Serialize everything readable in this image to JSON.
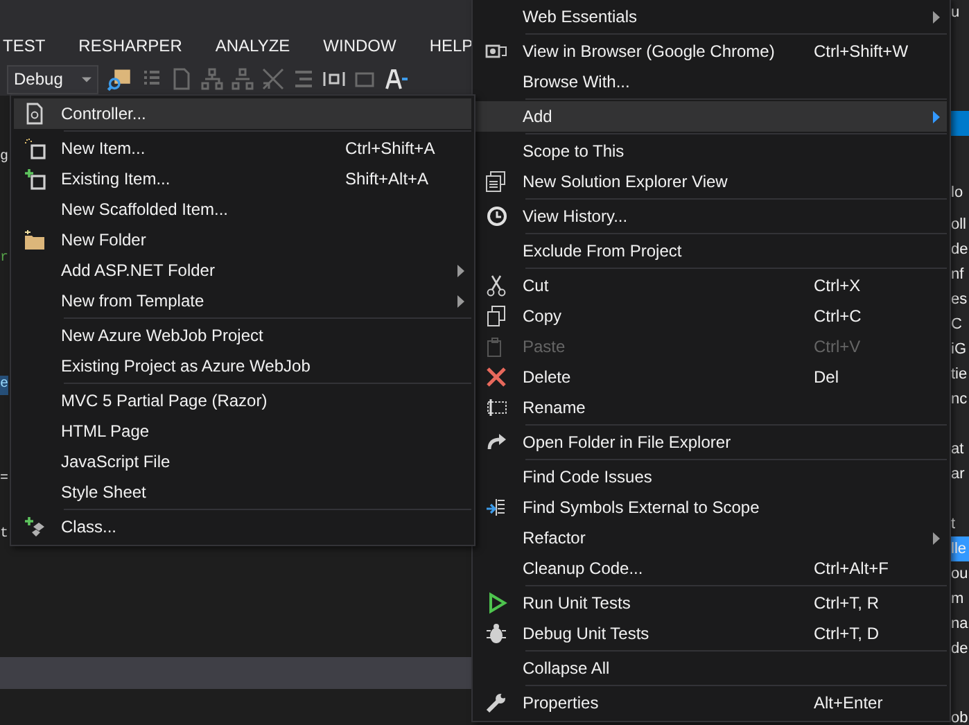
{
  "menubar": [
    {
      "label": "TEST"
    },
    {
      "label": "RESHARPER"
    },
    {
      "label": "ANALYZE"
    },
    {
      "label": "WINDOW"
    },
    {
      "label": "HELP"
    }
  ],
  "toolbar": {
    "configuration": "Debug"
  },
  "editor_fragments": [
    {
      "text": "g",
      "kind": "plain"
    },
    {
      "text": "r",
      "kind": "green"
    },
    {
      "text": "e",
      "kind": "highlight"
    },
    {
      "text": "=",
      "kind": "plain"
    },
    {
      "text": "t",
      "kind": "plain"
    }
  ],
  "solution_explorer": {
    "top_text": "u",
    "header_text": "lo",
    "rows": [
      {
        "kind": "row",
        "text": "oll",
        "selected": false
      },
      {
        "kind": "row",
        "text": "de",
        "selected": false
      },
      {
        "kind": "row",
        "text": "nf",
        "selected": false
      },
      {
        "kind": "row",
        "text": "es",
        "selected": false
      },
      {
        "kind": "row",
        "text": "C",
        "selected": false
      },
      {
        "kind": "row",
        "text": "iG",
        "selected": false
      },
      {
        "kind": "row",
        "text": "tie",
        "selected": false
      },
      {
        "kind": "row",
        "text": "nc",
        "selected": false
      },
      {
        "kind": "spacer"
      },
      {
        "kind": "row",
        "text": "at",
        "selected": false
      },
      {
        "kind": "row",
        "text": "ar",
        "selected": false
      },
      {
        "kind": "spacer"
      },
      {
        "kind": "row",
        "text": "t",
        "selected": false
      },
      {
        "kind": "row",
        "text": "lle",
        "selected": true
      },
      {
        "kind": "row",
        "text": "ou",
        "selected": false
      },
      {
        "kind": "row",
        "text": "m",
        "selected": false
      },
      {
        "kind": "row",
        "text": "na",
        "selected": false
      },
      {
        "kind": "row",
        "text": "de",
        "selected": false
      }
    ],
    "bottom_text": "ob"
  },
  "context_menu": {
    "items": [
      {
        "kind": "item",
        "label": "Web Essentials",
        "submenu": true,
        "selected": false,
        "disabled": false
      },
      {
        "kind": "separator"
      },
      {
        "kind": "item",
        "label": "View in Browser (Google Chrome)",
        "shortcut": "Ctrl+Shift+W",
        "selected": false,
        "disabled": false
      },
      {
        "kind": "item",
        "label": "Browse With...",
        "selected": false,
        "disabled": false
      },
      {
        "kind": "separator"
      },
      {
        "kind": "item",
        "label": "Add",
        "submenu": true,
        "selected": true,
        "disabled": false
      },
      {
        "kind": "separator"
      },
      {
        "kind": "item",
        "label": "Scope to This",
        "selected": false,
        "disabled": false
      },
      {
        "kind": "item",
        "label": "New Solution Explorer View",
        "selected": false,
        "disabled": false
      },
      {
        "kind": "separator"
      },
      {
        "kind": "item",
        "label": "View History...",
        "selected": false,
        "disabled": false
      },
      {
        "kind": "separator"
      },
      {
        "kind": "item",
        "label": "Exclude From Project",
        "selected": false,
        "disabled": false
      },
      {
        "kind": "separator"
      },
      {
        "kind": "item",
        "label": "Cut",
        "shortcut": "Ctrl+X",
        "selected": false,
        "disabled": false
      },
      {
        "kind": "item",
        "label": "Copy",
        "shortcut": "Ctrl+C",
        "selected": false,
        "disabled": false
      },
      {
        "kind": "item",
        "label": "Paste",
        "shortcut": "Ctrl+V",
        "selected": false,
        "disabled": true
      },
      {
        "kind": "item",
        "label": "Delete",
        "shortcut": "Del",
        "selected": false,
        "disabled": false
      },
      {
        "kind": "item",
        "label": "Rename",
        "selected": false,
        "disabled": false
      },
      {
        "kind": "separator"
      },
      {
        "kind": "item",
        "label": "Open Folder in File Explorer",
        "selected": false,
        "disabled": false
      },
      {
        "kind": "separator"
      },
      {
        "kind": "item",
        "label": "Find Code Issues",
        "selected": false,
        "disabled": false
      },
      {
        "kind": "item",
        "label": "Find Symbols External to Scope",
        "selected": false,
        "disabled": false
      },
      {
        "kind": "item",
        "label": "Refactor",
        "submenu": true,
        "selected": false,
        "disabled": false
      },
      {
        "kind": "item",
        "label": "Cleanup Code...",
        "shortcut": "Ctrl+Alt+F",
        "selected": false,
        "disabled": false
      },
      {
        "kind": "separator"
      },
      {
        "kind": "item",
        "label": "Run Unit Tests",
        "shortcut": "Ctrl+T, R",
        "selected": false,
        "disabled": false
      },
      {
        "kind": "item",
        "label": "Debug Unit Tests",
        "shortcut": "Ctrl+T, D",
        "selected": false,
        "disabled": false
      },
      {
        "kind": "separator"
      },
      {
        "kind": "item",
        "label": "Collapse All",
        "selected": false,
        "disabled": false
      },
      {
        "kind": "separator"
      },
      {
        "kind": "item",
        "label": "Properties",
        "shortcut": "Alt+Enter",
        "selected": false,
        "disabled": false
      }
    ]
  },
  "add_submenu": {
    "items": [
      {
        "kind": "item",
        "label": "Controller...",
        "selected": true,
        "disabled": false
      },
      {
        "kind": "separator"
      },
      {
        "kind": "item",
        "label": "New Item...",
        "shortcut": "Ctrl+Shift+A",
        "selected": false,
        "disabled": false
      },
      {
        "kind": "item",
        "label": "Existing Item...",
        "shortcut": "Shift+Alt+A",
        "selected": false,
        "disabled": false
      },
      {
        "kind": "item",
        "label": "New Scaffolded Item...",
        "selected": false,
        "disabled": false
      },
      {
        "kind": "item",
        "label": "New Folder",
        "selected": false,
        "disabled": false
      },
      {
        "kind": "item",
        "label": "Add ASP.NET Folder",
        "submenu": true,
        "selected": false,
        "disabled": false
      },
      {
        "kind": "item",
        "label": "New from Template",
        "submenu": true,
        "selected": false,
        "disabled": false
      },
      {
        "kind": "separator"
      },
      {
        "kind": "item",
        "label": "New Azure WebJob Project",
        "selected": false,
        "disabled": false
      },
      {
        "kind": "item",
        "label": "Existing Project as Azure WebJob",
        "selected": false,
        "disabled": false
      },
      {
        "kind": "separator"
      },
      {
        "kind": "item",
        "label": "MVC 5 Partial Page (Razor)",
        "selected": false,
        "disabled": false
      },
      {
        "kind": "item",
        "label": "HTML Page",
        "selected": false,
        "disabled": false
      },
      {
        "kind": "item",
        "label": "JavaScript File",
        "selected": false,
        "disabled": false
      },
      {
        "kind": "item",
        "label": "Style Sheet",
        "selected": false,
        "disabled": false
      },
      {
        "kind": "separator"
      },
      {
        "kind": "item",
        "label": "Class...",
        "selected": false,
        "disabled": false
      }
    ]
  }
}
